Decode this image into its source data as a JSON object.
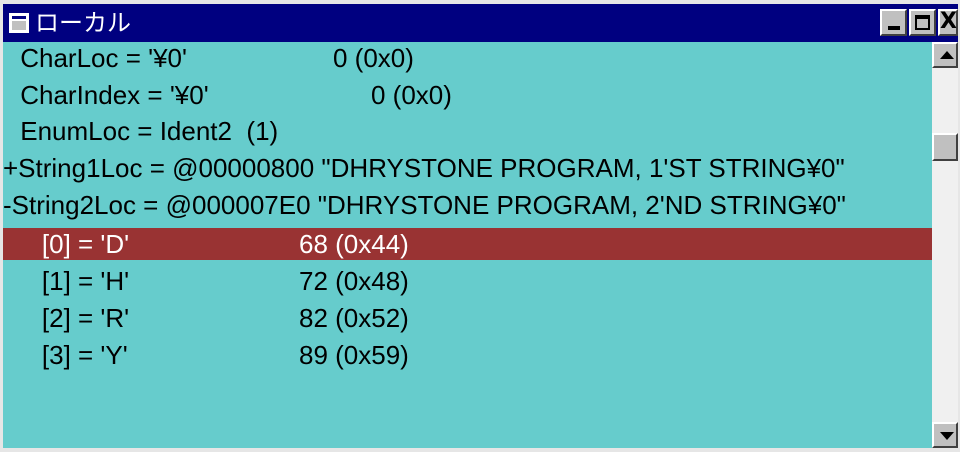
{
  "window": {
    "title": "ローカル",
    "minimize_label": "",
    "maximize_label": "",
    "close_label": "X"
  },
  "colors": {
    "titlebar": "#000080",
    "content_bg": "#66cccc",
    "selected_row_bg": "#993333",
    "selected_row_text": "#ffffff"
  },
  "variables": [
    {
      "expr": " CharLoc = '¥0'",
      "value": "0 (0x0)",
      "selected": false
    },
    {
      "expr": " CharIndex = '¥0'",
      "value": "0 (0x0)",
      "selected": false
    },
    {
      "expr": " EnumLoc = Ident2  (1)",
      "value": "",
      "selected": false
    },
    {
      "expr": "+String1Loc = @00000800 \"DHRYSTONE PROGRAM, 1'ST STRING¥0\"",
      "value": "",
      "selected": false
    },
    {
      "expr": "-String2Loc = @000007E0 \"DHRYSTONE PROGRAM, 2'ND STRING¥0\"",
      "value": "",
      "selected": false
    },
    {
      "expr": "    [0] = 'D'",
      "value": "68 (0x44)",
      "selected": true
    },
    {
      "expr": "    [1] = 'H'",
      "value": "72 (0x48)",
      "selected": false
    },
    {
      "expr": "    [2] = 'R'",
      "value": "82 (0x52)",
      "selected": false
    },
    {
      "expr": "    [3] = 'Y'",
      "value": "89 (0x59)",
      "selected": false
    }
  ]
}
